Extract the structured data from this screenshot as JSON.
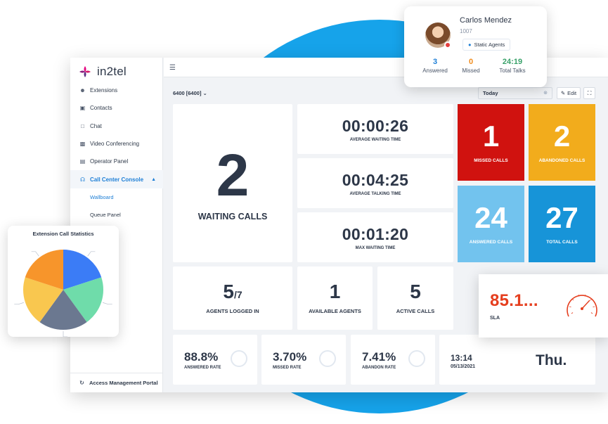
{
  "app": {
    "logo_text": "in2tel",
    "queue_select": "6400 [6400]",
    "date_filter": "Today",
    "edit_label": "Edit"
  },
  "sidebar": {
    "items": [
      {
        "label": "Extensions",
        "icon": "users-icon"
      },
      {
        "label": "Contacts",
        "icon": "contacts-icon"
      },
      {
        "label": "Chat",
        "icon": "chat-icon"
      },
      {
        "label": "Video Conferencing",
        "icon": "video-icon"
      },
      {
        "label": "Operator Panel",
        "icon": "monitor-icon"
      },
      {
        "label": "Call Center Console",
        "icon": "headset-icon",
        "active": true
      }
    ],
    "subitems": [
      {
        "label": "Wallboard",
        "active": true
      },
      {
        "label": "Queue Panel"
      }
    ],
    "footer_label": "Access Management Portal"
  },
  "wallboard": {
    "waiting_calls": {
      "value": "2",
      "label": "WAITING CALLS"
    },
    "avg_waiting": {
      "value": "00:00:26",
      "label": "AVERAGE WAITING TIME"
    },
    "avg_talking": {
      "value": "00:04:25",
      "label": "AVERAGE TALKING TIME"
    },
    "max_waiting": {
      "value": "00:01:20",
      "label": "MAX WAITING TIME"
    },
    "missed_calls": {
      "value": "1",
      "label": "MISSED CALLS",
      "color": "#d0120f"
    },
    "abandoned_calls": {
      "value": "2",
      "label": "ABANDONED CALLS",
      "color": "#f2ac1c"
    },
    "answered_calls": {
      "value": "24",
      "label": "ANSWERED CALLS",
      "color": "#72c3ee"
    },
    "total_calls": {
      "value": "27",
      "label": "TOTAL CALLS",
      "color": "#1794d8"
    },
    "agents_logged_in": {
      "value": "5",
      "total": "/7",
      "label": "AGENTS LOGGED IN"
    },
    "available_agents": {
      "value": "1",
      "label": "AVAILABLE AGENTS"
    },
    "active_calls": {
      "value": "5",
      "label": "ACTIVE CALLS"
    },
    "answered_rate": {
      "value": "88.8%",
      "label": "ANSWERED RATE"
    },
    "missed_rate": {
      "value": "3.70%",
      "label": "MISSED RATE"
    },
    "abandon_rate": {
      "value": "7.41%",
      "label": "ABANDON RATE"
    },
    "clock": {
      "time": "13:14",
      "date": "05/13/2021",
      "day": "Thu."
    }
  },
  "agent_card": {
    "name": "Carlos Mendez",
    "extension": "1007",
    "badge": "Static Agents",
    "stats": [
      {
        "value": "3",
        "label": "Answered",
        "color": "#1e7fd6"
      },
      {
        "value": "0",
        "label": "Missed",
        "color": "#f08c1c"
      },
      {
        "value": "24:19",
        "label": "Total Talks",
        "color": "#38a169"
      }
    ]
  },
  "pie_card": {
    "title": "Extension Call Statistics",
    "slices": [
      {
        "color": "#3b7cf6",
        "fraction": 0.2
      },
      {
        "color": "#6fdcaa",
        "fraction": 0.2
      },
      {
        "color": "#6b7890",
        "fraction": 0.2
      },
      {
        "color": "#f9c74f",
        "fraction": 0.2
      },
      {
        "color": "#f7952b",
        "fraction": 0.2
      }
    ]
  },
  "sla_card": {
    "value": "85.1...",
    "label": "SLA",
    "gauge_color": "#e53e1e"
  }
}
